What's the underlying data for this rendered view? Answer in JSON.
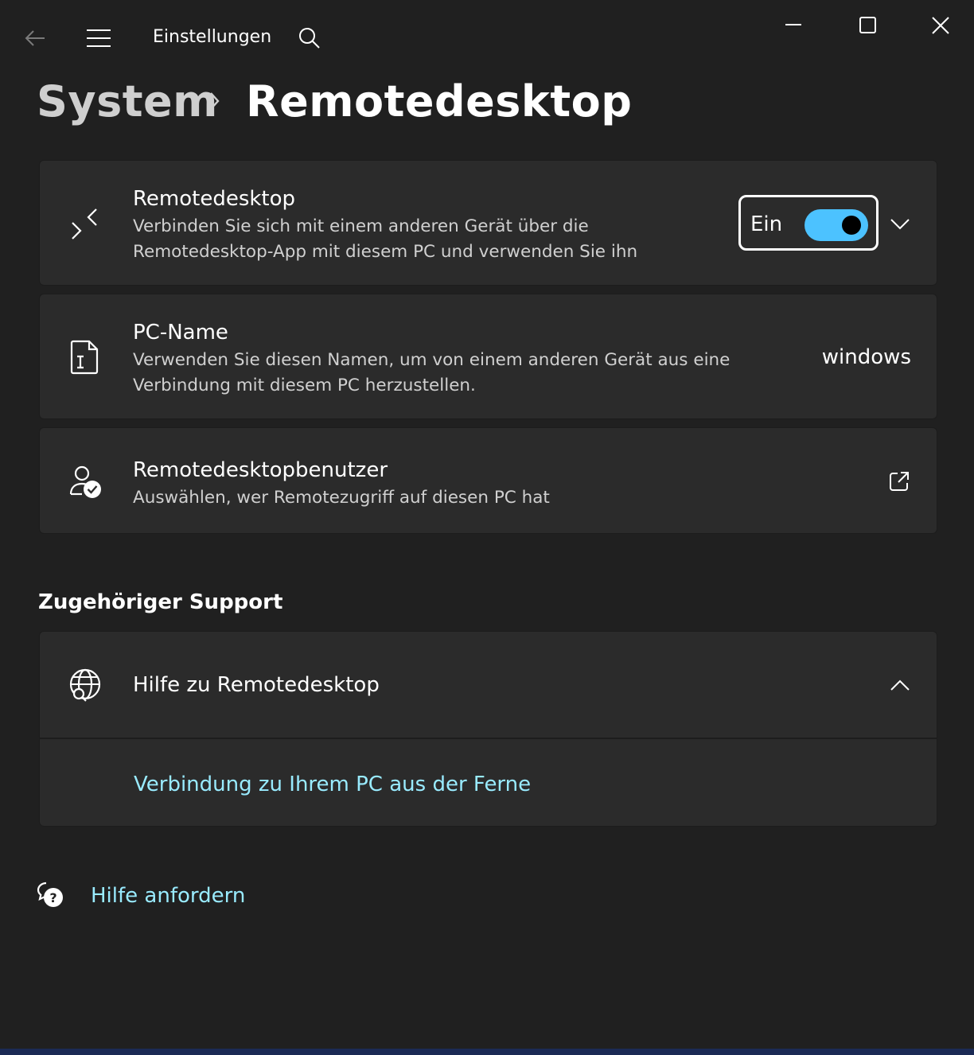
{
  "titlebar": {
    "app_title": "Einstellungen",
    "icons": [
      "back-arrow-icon",
      "hamburger-menu-icon",
      "search-icon",
      "minimize-icon",
      "maximize-icon",
      "close-icon"
    ]
  },
  "breadcrumb": {
    "parent": "System",
    "current": "Remotedesktop"
  },
  "cards": {
    "remote_desktop": {
      "title": "Remotedesktop",
      "desc_line1": "Verbinden Sie sich mit einem anderen Gerät über die",
      "desc_line2": "Remotedesktop-App mit diesem PC und verwenden Sie ihn",
      "toggle_label": "Ein",
      "toggle_on": true,
      "icon": "remote-desktop-icon"
    },
    "pc_name": {
      "title": "PC-Name",
      "desc_line1": "Verwenden Sie diesen Namen, um von einem anderen Gerät aus eine",
      "desc_line2": "Verbindung mit diesem PC herzustellen.",
      "value": "windows",
      "icon": "pc-name-icon"
    },
    "remote_users": {
      "title": "Remotedesktopbenutzer",
      "desc": "Auswählen, wer Remotezugriff auf diesen PC hat",
      "icon": "user-check-icon"
    }
  },
  "support": {
    "heading": "Zugehöriger Support",
    "help_title": "Hilfe zu Remotedesktop",
    "help_link": "Verbindung zu Ihrem PC aus der Ferne"
  },
  "footer": {
    "get_help": "Hilfe anfordern"
  },
  "colors": {
    "background": "#202020",
    "card": "#2b2b2b",
    "accent": "#4cc2ff",
    "link": "#99ebff"
  }
}
